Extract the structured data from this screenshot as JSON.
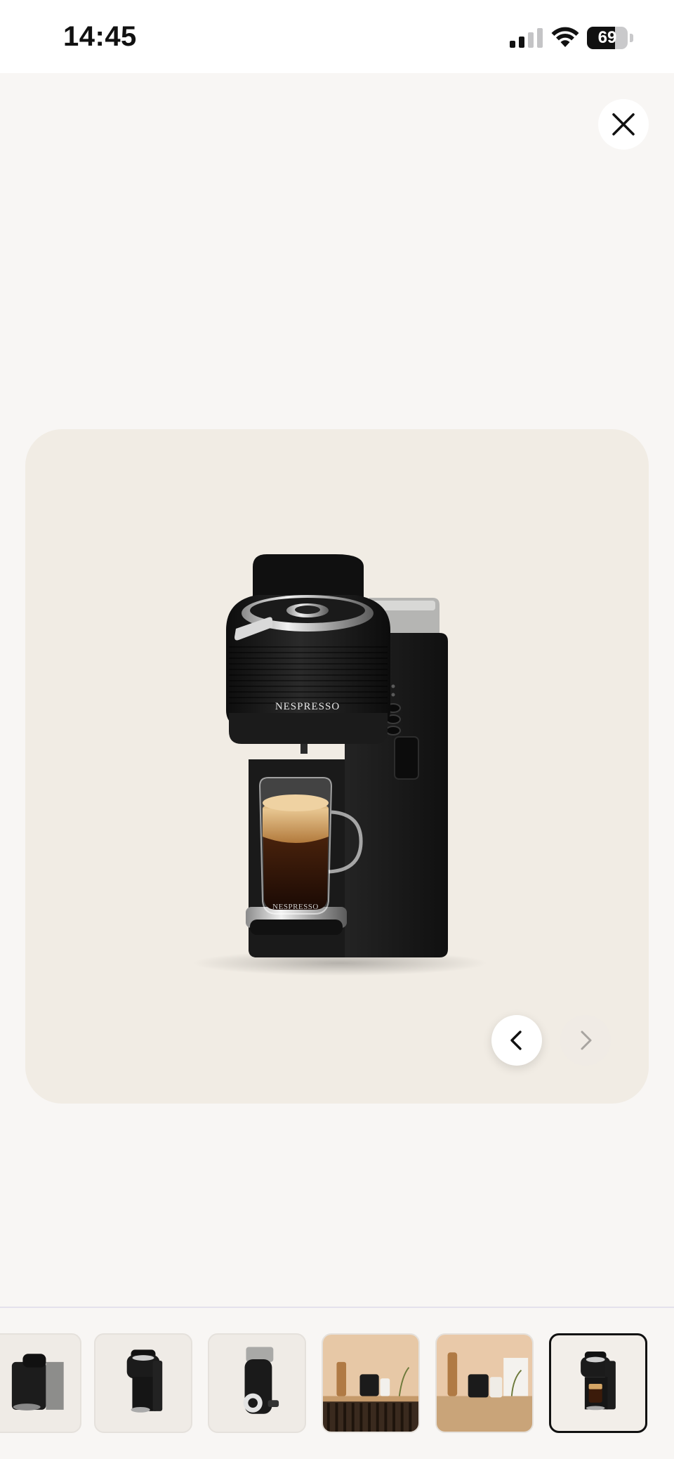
{
  "status_bar": {
    "time": "14:45",
    "battery_level": "69",
    "battery_fraction": 0.69,
    "icons": [
      "cellular-signal-icon",
      "wifi-icon",
      "battery-icon"
    ]
  },
  "viewer": {
    "close_icon": "close-icon",
    "brand_mark": "NESPRESSO",
    "cup_brand_mark": "NESPRESSO",
    "prev_icon": "chevron-left-icon",
    "next_icon": "chevron-right-icon",
    "next_enabled": false,
    "background_color": "#f1ece4"
  },
  "thumbnails": {
    "count_visible": 6,
    "active_index": 5,
    "items": [
      {
        "kind": "machine-side-partial"
      },
      {
        "kind": "machine-front"
      },
      {
        "kind": "machine-back"
      },
      {
        "kind": "lifestyle-kitchen"
      },
      {
        "kind": "lifestyle-kitchen-2"
      },
      {
        "kind": "machine-with-cup",
        "selected": true
      }
    ]
  }
}
